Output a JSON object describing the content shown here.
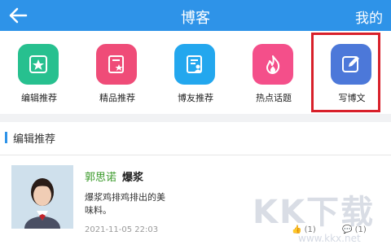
{
  "header": {
    "title": "博客",
    "right": "我的"
  },
  "nav": [
    {
      "label": "编辑推荐",
      "color": "#27c08f"
    },
    {
      "label": "精品推荐",
      "color": "#ef4c78"
    },
    {
      "label": "博友推荐",
      "color": "#23a7ee"
    },
    {
      "label": "热点话题",
      "color": "#f44f8a"
    },
    {
      "label": "写博文",
      "color": "#4c78d9"
    }
  ],
  "section": {
    "title": "编辑推荐"
  },
  "post": {
    "author": "郭思诺",
    "headline": "爆浆",
    "excerpt": "爆浆鸡排鸡排出的美味料。",
    "time": "2021-11-05 22:03",
    "likes": "(1)",
    "comments": "(1)"
  },
  "watermark": {
    "text": "KK下载",
    "url": "www.kkx.net"
  }
}
